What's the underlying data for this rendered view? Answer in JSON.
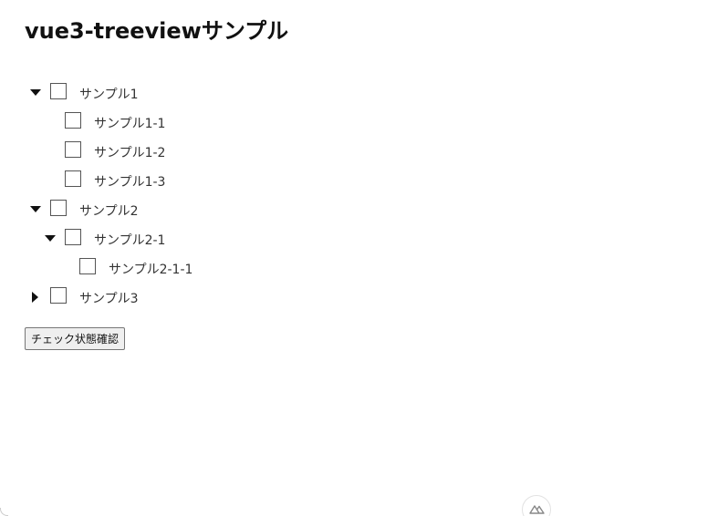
{
  "page": {
    "title": "vue3-treeviewサンプル"
  },
  "tree": {
    "nodes": [
      {
        "label": "サンプル1",
        "level": 0,
        "toggle": "expanded",
        "checked": false
      },
      {
        "label": "サンプル1-1",
        "level": 1,
        "toggle": "none",
        "checked": false
      },
      {
        "label": "サンプル1-2",
        "level": 1,
        "toggle": "none",
        "checked": false
      },
      {
        "label": "サンプル1-3",
        "level": 1,
        "toggle": "none",
        "checked": false
      },
      {
        "label": "サンプル2",
        "level": 0,
        "toggle": "expanded",
        "checked": false
      },
      {
        "label": "サンプル2-1",
        "level": 1,
        "toggle": "expanded",
        "checked": false
      },
      {
        "label": "サンプル2-1-1",
        "level": 2,
        "toggle": "none",
        "checked": false
      },
      {
        "label": "サンプル3",
        "level": 0,
        "toggle": "collapsed",
        "checked": false
      }
    ]
  },
  "actions": {
    "check_state_button": "チェック状態確認"
  },
  "icons": {
    "expanded": "caret-down-icon",
    "collapsed": "caret-right-icon",
    "badge": "nuxt-logo-icon"
  }
}
